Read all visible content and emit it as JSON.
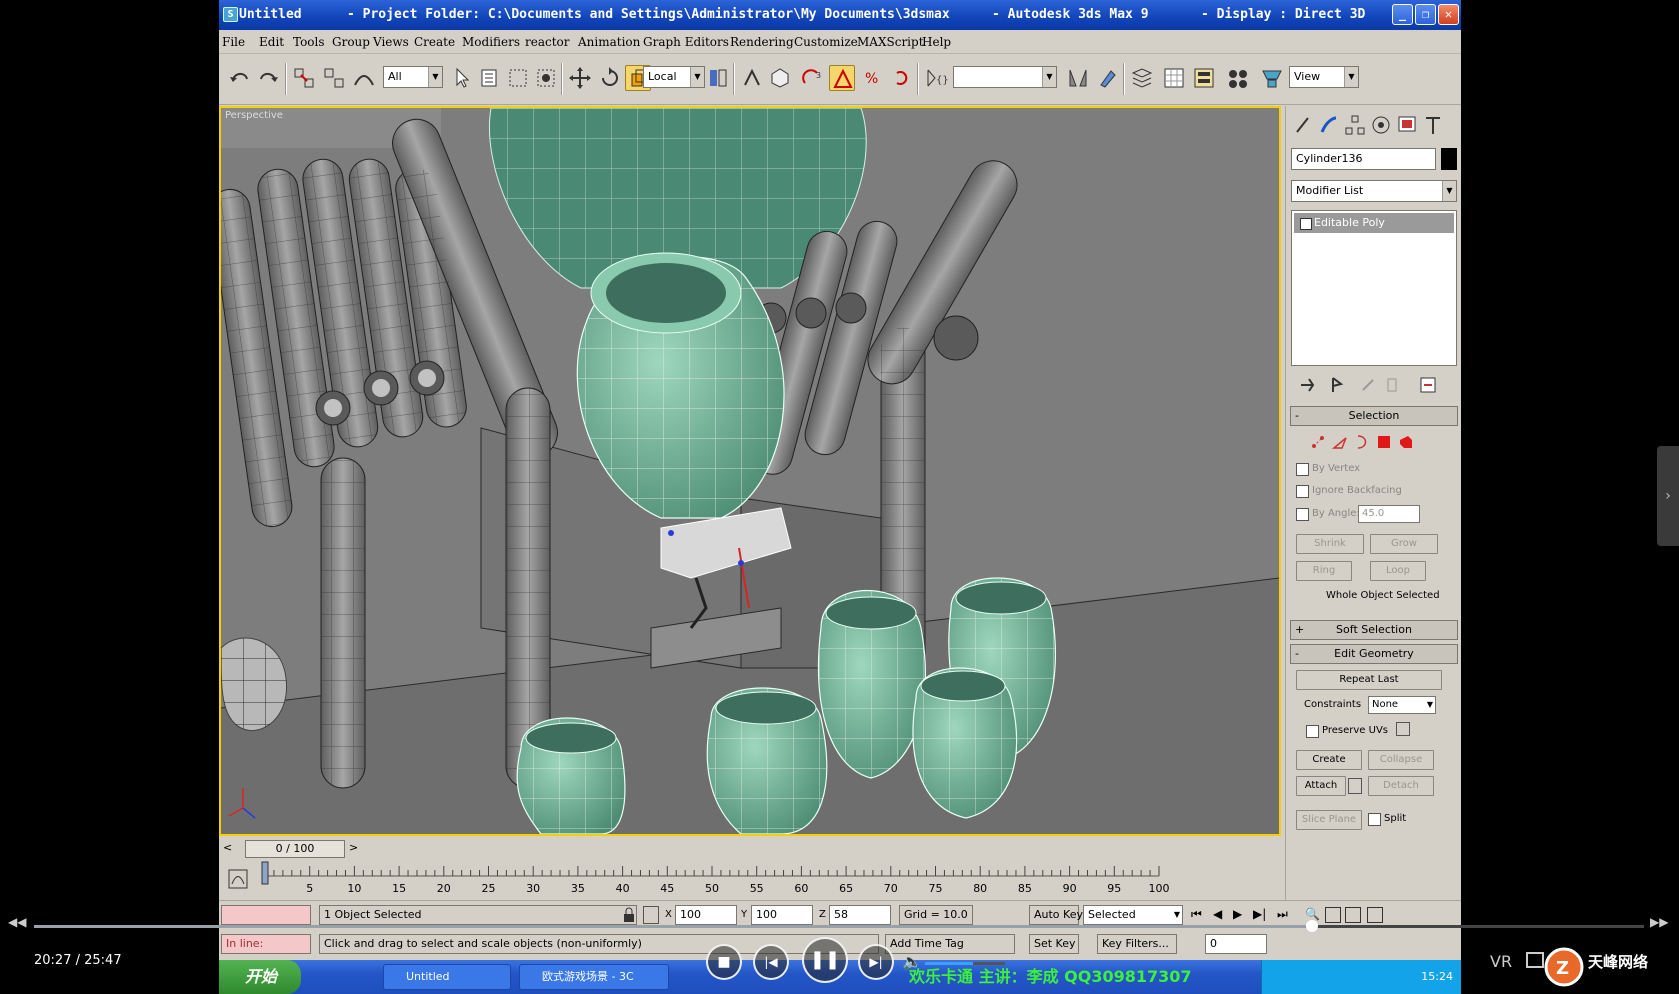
{
  "window": {
    "title_file": "Untitled",
    "title_project": "- Project Folder: C:\\Documents and Settings\\Administrator\\My Documents\\3dsmax",
    "title_app": "- Autodesk 3ds Max 9",
    "title_display": "- Display : Direct 3D"
  },
  "menu": [
    "File",
    "Edit",
    "Tools",
    "Group",
    "Views",
    "Create",
    "Modifiers",
    "reactor",
    "Animation",
    "Graph Editors",
    "Rendering",
    "Customize",
    "MAXScript",
    "Help"
  ],
  "toolbar": {
    "selection_filter": "All",
    "coord_system": "Local",
    "named_selection": "",
    "view_dropdown": "View"
  },
  "viewport": {
    "label": "Perspective"
  },
  "command_panel": {
    "object_name": "Cylinder136",
    "modifier_list": "Modifier List",
    "stack_item": "Editable Poly",
    "selection": {
      "title": "Selection",
      "by_vertex": "By Vertex",
      "ignore_backfacing": "Ignore Backfacing",
      "by_angle": "By Angle:",
      "by_angle_value": "45.0",
      "shrink": "Shrink",
      "grow": "Grow",
      "ring": "Ring",
      "loop": "Loop",
      "status": "Whole Object Selected"
    },
    "soft_selection": "Soft Selection",
    "edit_geometry": {
      "title": "Edit Geometry",
      "repeat_last": "Repeat Last",
      "constraints_label": "Constraints",
      "constraints_value": "None",
      "preserve_uvs": "Preserve UVs",
      "create": "Create",
      "collapse": "Collapse",
      "attach": "Attach",
      "detach": "Detach",
      "slice_plane": "Slice Plane",
      "split": "Split"
    }
  },
  "time": {
    "slider": "0 / 100",
    "ticks": [
      "5",
      "10",
      "15",
      "20",
      "25",
      "30",
      "35",
      "40",
      "45",
      "50",
      "55",
      "60",
      "65",
      "70",
      "75",
      "80",
      "85",
      "90",
      "95",
      "100"
    ]
  },
  "status": {
    "selection": "1 Object Selected",
    "x": "100",
    "y": "100",
    "z": "58",
    "grid": "Grid = 10.0",
    "auto_key": "Auto Key",
    "key_mode": "Selected",
    "prompt": "Click and drag to select and scale objects (non-uniformly)",
    "in_line": "In line:",
    "add_time_tag": "Add Time Tag",
    "set_key": "Set Key",
    "key_filters": "Key Filters...",
    "frame": "0"
  },
  "taskbar": {
    "start": "开始",
    "task1": "Untitled",
    "task2": "欧式游戏场景 - 3C",
    "marquee": "欢乐卡通  主讲：李成 QQ309817307",
    "clock": "15:24"
  },
  "player": {
    "elapsed": "20:27",
    "total": "25:47",
    "progress": 0.794,
    "volume": 0.6,
    "vr": "VR",
    "watermark": "天峰网络"
  }
}
